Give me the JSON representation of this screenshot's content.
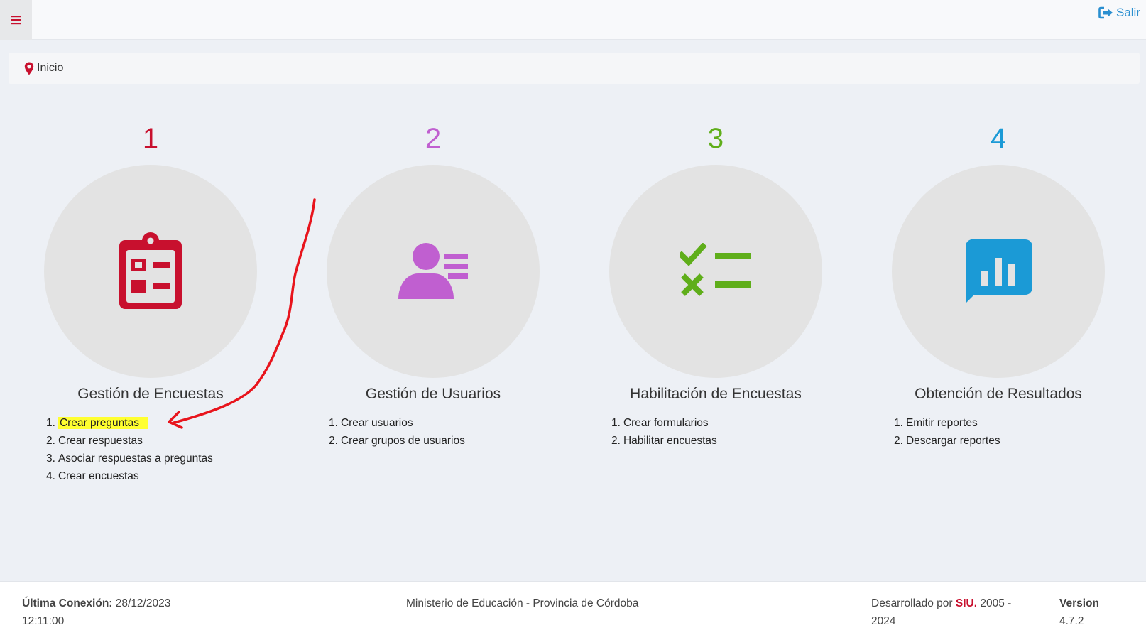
{
  "header": {
    "menu_icon": "hamburger-icon",
    "logout_label": "Salir",
    "logout_icon": "sign-out-icon"
  },
  "breadcrumb": {
    "icon": "map-marker-icon",
    "label": "Inicio"
  },
  "columns": [
    {
      "number": "1",
      "color": "#c8102e",
      "icon": "clipboard-list-icon",
      "title": "Gestión de Encuestas",
      "steps": [
        {
          "n": "1.",
          "label": "Crear preguntas"
        },
        {
          "n": "2.",
          "label": "Crear respuestas"
        },
        {
          "n": "3.",
          "label": "Asociar respuestas a preguntas"
        },
        {
          "n": "4.",
          "label": "Crear encuestas"
        }
      ]
    },
    {
      "number": "2",
      "color": "#c05fd0",
      "icon": "user-list-icon",
      "title": "Gestión de Usuarios",
      "steps": [
        {
          "n": "1.",
          "label": "Crear usuarios"
        },
        {
          "n": "2.",
          "label": "Crear grupos de usuarios"
        }
      ]
    },
    {
      "number": "3",
      "color": "#5fae1a",
      "icon": "check-x-list-icon",
      "title": "Habilitación de Encuestas",
      "steps": [
        {
          "n": "1.",
          "label": "Crear formularios"
        },
        {
          "n": "2.",
          "label": "Habilitar encuestas"
        }
      ]
    },
    {
      "number": "4",
      "color": "#1b9ad6",
      "icon": "chart-comment-icon",
      "title": "Obtención de Resultados",
      "steps": [
        {
          "n": "1.",
          "label": "Emitir reportes"
        },
        {
          "n": "2.",
          "label": "Descargar reportes"
        }
      ]
    }
  ],
  "footer": {
    "last_login_label": "Última Conexión:",
    "last_login_date": "28/12/2023",
    "last_login_time": "12:11:00",
    "ministry": "Ministerio de Educación - Provincia de Córdoba",
    "dev_prefix": "Desarrollado por",
    "dev_name": "SIU.",
    "dev_years_a": "2005 -",
    "dev_years_b": "2024",
    "version_label": "Version",
    "version_value": "4.7.2"
  },
  "colors": {
    "highlight": "#ffff30",
    "annotation_arrow": "#e8141c",
    "logout": "#2a8fd0"
  }
}
